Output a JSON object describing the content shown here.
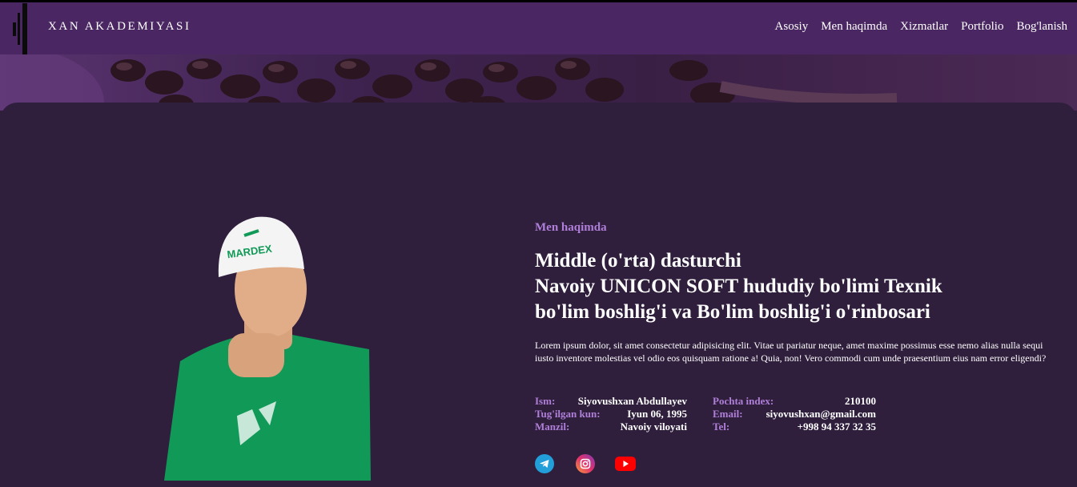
{
  "brand": "XAN AKADEMIYASI",
  "nav": [
    "Asosiy",
    "Men haqimda",
    "Xizmatlar",
    "Portfolio",
    "Bog'lanish"
  ],
  "about": {
    "label": "Men haqimda",
    "title_lines": [
      "Middle (o'rta) dasturchi",
      "Navoiy UNICON SOFT hududiy bo'limi Texnik",
      "bo'lim boshlig'i va Bo'lim boshlig'i o'rinbosari"
    ],
    "description": "Lorem ipsum dolor, sit amet consectetur adipisicing elit. Vitae ut pariatur neque, amet maxime possimus esse nemo alias nulla sequi iusto inventore molestias vel odio eos quisquam ratione a! Quia, non! Vero commodi cum unde praesentium eius nam error eligendi?",
    "info_left": [
      {
        "label": "Ism:",
        "value": "Siyovushxan Abdullayev"
      },
      {
        "label": "Tug'ilgan kun:",
        "value": "Iyun 06, 1995"
      },
      {
        "label": "Manzil:",
        "value": "Navoiy viloyati"
      }
    ],
    "info_right": [
      {
        "label": "Pochta index:",
        "value": "210100"
      },
      {
        "label": "Email:",
        "value": "siyovushxan@gmail.com"
      },
      {
        "label": "Tel:",
        "value": "+998 94 337 32 35"
      }
    ],
    "cap_text": "MARDEX"
  },
  "social": [
    "telegram-icon",
    "instagram-icon",
    "youtube-icon"
  ],
  "colors": {
    "navbar": "#4a2763",
    "background": "#2f1f3d",
    "accent": "#b07fd9",
    "shirt": "#119a57"
  }
}
